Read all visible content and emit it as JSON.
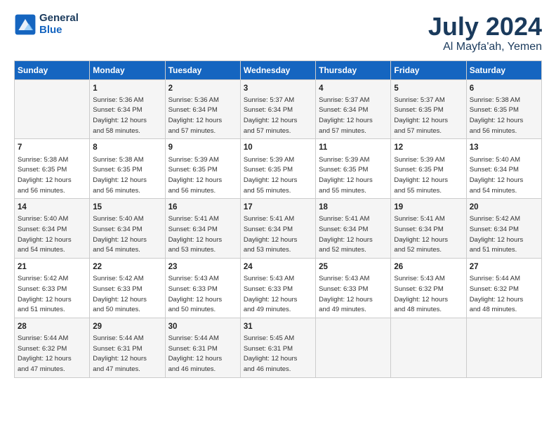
{
  "header": {
    "logo_line1": "General",
    "logo_line2": "Blue",
    "main_title": "July 2024",
    "sub_title": "Al Mayfa'ah, Yemen"
  },
  "columns": [
    "Sunday",
    "Monday",
    "Tuesday",
    "Wednesday",
    "Thursday",
    "Friday",
    "Saturday"
  ],
  "weeks": [
    [
      {
        "day": "",
        "info": ""
      },
      {
        "day": "1",
        "info": "Sunrise: 5:36 AM\nSunset: 6:34 PM\nDaylight: 12 hours\nand 58 minutes."
      },
      {
        "day": "2",
        "info": "Sunrise: 5:36 AM\nSunset: 6:34 PM\nDaylight: 12 hours\nand 57 minutes."
      },
      {
        "day": "3",
        "info": "Sunrise: 5:37 AM\nSunset: 6:34 PM\nDaylight: 12 hours\nand 57 minutes."
      },
      {
        "day": "4",
        "info": "Sunrise: 5:37 AM\nSunset: 6:34 PM\nDaylight: 12 hours\nand 57 minutes."
      },
      {
        "day": "5",
        "info": "Sunrise: 5:37 AM\nSunset: 6:35 PM\nDaylight: 12 hours\nand 57 minutes."
      },
      {
        "day": "6",
        "info": "Sunrise: 5:38 AM\nSunset: 6:35 PM\nDaylight: 12 hours\nand 56 minutes."
      }
    ],
    [
      {
        "day": "7",
        "info": "Sunrise: 5:38 AM\nSunset: 6:35 PM\nDaylight: 12 hours\nand 56 minutes."
      },
      {
        "day": "8",
        "info": "Sunrise: 5:38 AM\nSunset: 6:35 PM\nDaylight: 12 hours\nand 56 minutes."
      },
      {
        "day": "9",
        "info": "Sunrise: 5:39 AM\nSunset: 6:35 PM\nDaylight: 12 hours\nand 56 minutes."
      },
      {
        "day": "10",
        "info": "Sunrise: 5:39 AM\nSunset: 6:35 PM\nDaylight: 12 hours\nand 55 minutes."
      },
      {
        "day": "11",
        "info": "Sunrise: 5:39 AM\nSunset: 6:35 PM\nDaylight: 12 hours\nand 55 minutes."
      },
      {
        "day": "12",
        "info": "Sunrise: 5:39 AM\nSunset: 6:35 PM\nDaylight: 12 hours\nand 55 minutes."
      },
      {
        "day": "13",
        "info": "Sunrise: 5:40 AM\nSunset: 6:34 PM\nDaylight: 12 hours\nand 54 minutes."
      }
    ],
    [
      {
        "day": "14",
        "info": "Sunrise: 5:40 AM\nSunset: 6:34 PM\nDaylight: 12 hours\nand 54 minutes."
      },
      {
        "day": "15",
        "info": "Sunrise: 5:40 AM\nSunset: 6:34 PM\nDaylight: 12 hours\nand 54 minutes."
      },
      {
        "day": "16",
        "info": "Sunrise: 5:41 AM\nSunset: 6:34 PM\nDaylight: 12 hours\nand 53 minutes."
      },
      {
        "day": "17",
        "info": "Sunrise: 5:41 AM\nSunset: 6:34 PM\nDaylight: 12 hours\nand 53 minutes."
      },
      {
        "day": "18",
        "info": "Sunrise: 5:41 AM\nSunset: 6:34 PM\nDaylight: 12 hours\nand 52 minutes."
      },
      {
        "day": "19",
        "info": "Sunrise: 5:41 AM\nSunset: 6:34 PM\nDaylight: 12 hours\nand 52 minutes."
      },
      {
        "day": "20",
        "info": "Sunrise: 5:42 AM\nSunset: 6:34 PM\nDaylight: 12 hours\nand 51 minutes."
      }
    ],
    [
      {
        "day": "21",
        "info": "Sunrise: 5:42 AM\nSunset: 6:33 PM\nDaylight: 12 hours\nand 51 minutes."
      },
      {
        "day": "22",
        "info": "Sunrise: 5:42 AM\nSunset: 6:33 PM\nDaylight: 12 hours\nand 50 minutes."
      },
      {
        "day": "23",
        "info": "Sunrise: 5:43 AM\nSunset: 6:33 PM\nDaylight: 12 hours\nand 50 minutes."
      },
      {
        "day": "24",
        "info": "Sunrise: 5:43 AM\nSunset: 6:33 PM\nDaylight: 12 hours\nand 49 minutes."
      },
      {
        "day": "25",
        "info": "Sunrise: 5:43 AM\nSunset: 6:33 PM\nDaylight: 12 hours\nand 49 minutes."
      },
      {
        "day": "26",
        "info": "Sunrise: 5:43 AM\nSunset: 6:32 PM\nDaylight: 12 hours\nand 48 minutes."
      },
      {
        "day": "27",
        "info": "Sunrise: 5:44 AM\nSunset: 6:32 PM\nDaylight: 12 hours\nand 48 minutes."
      }
    ],
    [
      {
        "day": "28",
        "info": "Sunrise: 5:44 AM\nSunset: 6:32 PM\nDaylight: 12 hours\nand 47 minutes."
      },
      {
        "day": "29",
        "info": "Sunrise: 5:44 AM\nSunset: 6:31 PM\nDaylight: 12 hours\nand 47 minutes."
      },
      {
        "day": "30",
        "info": "Sunrise: 5:44 AM\nSunset: 6:31 PM\nDaylight: 12 hours\nand 46 minutes."
      },
      {
        "day": "31",
        "info": "Sunrise: 5:45 AM\nSunset: 6:31 PM\nDaylight: 12 hours\nand 46 minutes."
      },
      {
        "day": "",
        "info": ""
      },
      {
        "day": "",
        "info": ""
      },
      {
        "day": "",
        "info": ""
      }
    ]
  ]
}
